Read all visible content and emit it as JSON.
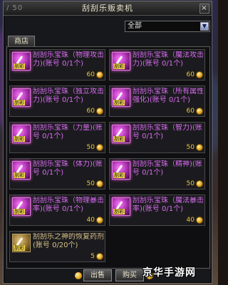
{
  "window": {
    "title": "刮刮乐贩卖机",
    "counter": "/ 50",
    "close_glyph": "×"
  },
  "filter": {
    "selected": "全部",
    "arrow_glyph": "▼"
  },
  "tabs": [
    {
      "label": "商店"
    }
  ],
  "thumb_tag": "刮彩",
  "items": [
    {
      "name": "刮刮乐宝珠（物理攻击力)(账号 0/1个)",
      "price": "60",
      "style": "pink"
    },
    {
      "name": "刮刮乐宝珠（魔法攻击力)(账号 0/1个)",
      "price": "60",
      "style": "pink"
    },
    {
      "name": "刮刮乐宝珠（独立攻击力)(账号 0/1个)",
      "price": "60",
      "style": "pink"
    },
    {
      "name": "刮刮乐宝珠（所有属性强化)(账号 0/1个)",
      "price": "60",
      "style": "pink"
    },
    {
      "name": "刮刮乐宝珠（力量)(账号 0/1个)",
      "price": "50",
      "style": "pink"
    },
    {
      "name": "刮刮乐宝珠（智力)(账号 0/1个)",
      "price": "50",
      "style": "pink"
    },
    {
      "name": "刮刮乐宝珠（体力)(账号 0/1个)",
      "price": "50",
      "style": "pink"
    },
    {
      "name": "刮刮乐宝珠（精神)(账号 0/1个)",
      "price": "50",
      "style": "pink"
    },
    {
      "name": "刮刮乐宝珠（物理暴击率)(账号 0/1个)",
      "price": "40",
      "style": "pink"
    },
    {
      "name": "刮刮乐宝珠（魔法暴击率)(账号 0/1个)",
      "price": "40",
      "style": "pink"
    },
    {
      "name": "刮刮乐之神的恢复药剂(账号 0/20个)",
      "price": "5",
      "style": "gold"
    }
  ],
  "buttons": {
    "sell": "出售",
    "buy": "购买"
  },
  "watermark": "京华手游网"
}
